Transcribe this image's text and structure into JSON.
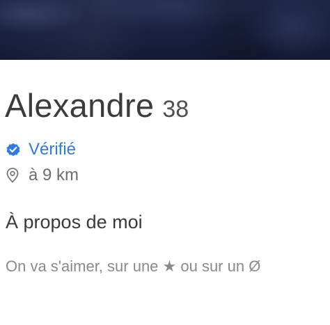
{
  "profile": {
    "name": "Alexandre",
    "age": "38",
    "verified_label": "Vérifié",
    "distance": "à 9 km",
    "about_title": "À propos de moi",
    "bio": "On va s'aimer, sur une ★ ou sur un Ø"
  },
  "colors": {
    "accent": "#2e7ae0",
    "photo_dark": "#1a2140"
  },
  "icons": {
    "verified": "verified-badge-icon",
    "location": "location-pin-icon"
  }
}
